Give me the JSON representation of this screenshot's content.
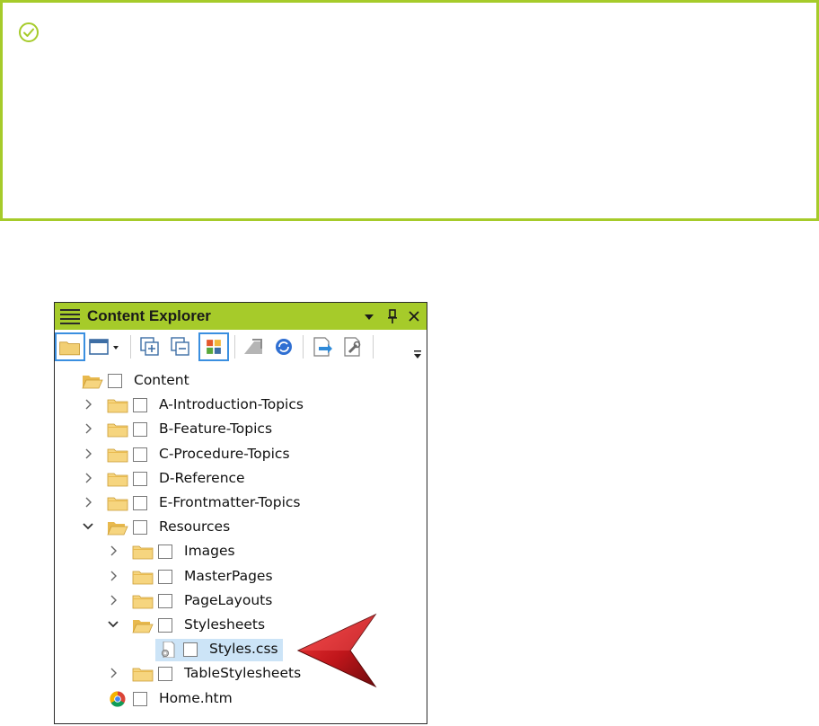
{
  "callout": {
    "icon": "check-circle-icon",
    "border_color": "#a6cb2a"
  },
  "panel": {
    "title": "Content Explorer",
    "title_bar_color": "#a6cb2a",
    "controls": [
      "dropdown-arrow-icon",
      "pin-icon",
      "close-icon"
    ]
  },
  "toolbar": {
    "buttons": [
      "folder-view-icon",
      "layout-icon",
      "expand-all-icon",
      "collapse-all-icon",
      "color-grid-icon",
      "move-icon",
      "refresh-icon",
      "open-icon",
      "properties-icon",
      "overflow-icon"
    ]
  },
  "tree": [
    {
      "label": "Content",
      "level": 0,
      "type": "folder-open",
      "expanded": true
    },
    {
      "label": "A-Introduction-Topics",
      "level": 1,
      "type": "folder",
      "expanded": false
    },
    {
      "label": "B-Feature-Topics",
      "level": 1,
      "type": "folder",
      "expanded": false
    },
    {
      "label": "C-Procedure-Topics",
      "level": 1,
      "type": "folder",
      "expanded": false
    },
    {
      "label": "D-Reference",
      "level": 1,
      "type": "folder",
      "expanded": false
    },
    {
      "label": "E-Frontmatter-Topics",
      "level": 1,
      "type": "folder",
      "expanded": false
    },
    {
      "label": "Resources",
      "level": 1,
      "type": "folder-open",
      "expanded": true
    },
    {
      "label": "Images",
      "level": 2,
      "type": "folder",
      "expanded": false
    },
    {
      "label": "MasterPages",
      "level": 2,
      "type": "folder",
      "expanded": false
    },
    {
      "label": "PageLayouts",
      "level": 2,
      "type": "folder",
      "expanded": false
    },
    {
      "label": "Stylesheets",
      "level": 2,
      "type": "folder-open",
      "expanded": true
    },
    {
      "label": "Styles.css",
      "level": 3,
      "type": "css-file",
      "selected": true
    },
    {
      "label": "TableStylesheets",
      "level": 2,
      "type": "folder",
      "expanded": false
    },
    {
      "label": "Home.htm",
      "level": 1,
      "type": "chrome-file"
    }
  ],
  "pointer": {
    "icon": "red-arrow-pointer-icon",
    "color": "#c0161b"
  }
}
